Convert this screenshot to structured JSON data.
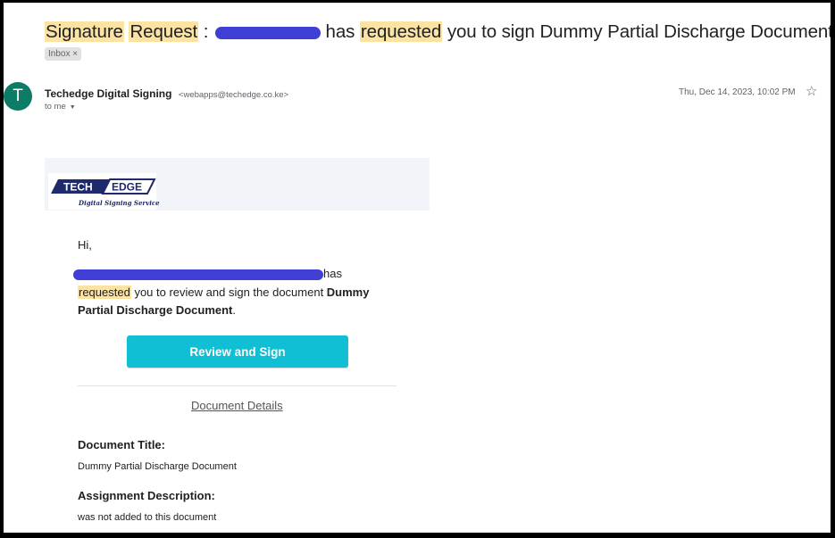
{
  "email": {
    "subject_before": "Signature",
    "subject_word2": "Request",
    "subject_colon": " :",
    "subject_middle": "has",
    "subject_word3": "requested",
    "subject_after": "you to sign Dummy Partial Discharge Document.pdf",
    "inbox_label": "Inbox",
    "inbox_close": "×",
    "avatar_letter": "T",
    "sender_name": "Techedge Digital Signing",
    "sender_email": "<webapps@techedge.co.ke>",
    "to_label": "to me",
    "date": "Thu, Dec 14, 2023, 10:02 PM",
    "star_icon": "star-outline-icon"
  },
  "body": {
    "logo_text_left": "TECH",
    "logo_text_right": "EDGE",
    "logo_tagline": "Digital Signing Service",
    "greeting": "Hi,",
    "line1_after": "has",
    "line2_highlight": "requested",
    "line2_rest": " you to review and sign the document ",
    "line2_bold": "Dummy",
    "line3_bold": "Partial Discharge Document",
    "line3_end": ".",
    "button_label": "Review and Sign",
    "details_link": "Document Details",
    "title_label": "Document Title:",
    "title_value": "Dummy Partial Discharge Document",
    "desc_label": "Assignment Description:",
    "desc_value": "was not added to this document"
  },
  "colors": {
    "highlight": "#fbe3a4",
    "avatar": "#0d7c67",
    "button": "#10bfd4",
    "redaction": "#3f3fd6",
    "logo_navy": "#1e2a6b"
  }
}
